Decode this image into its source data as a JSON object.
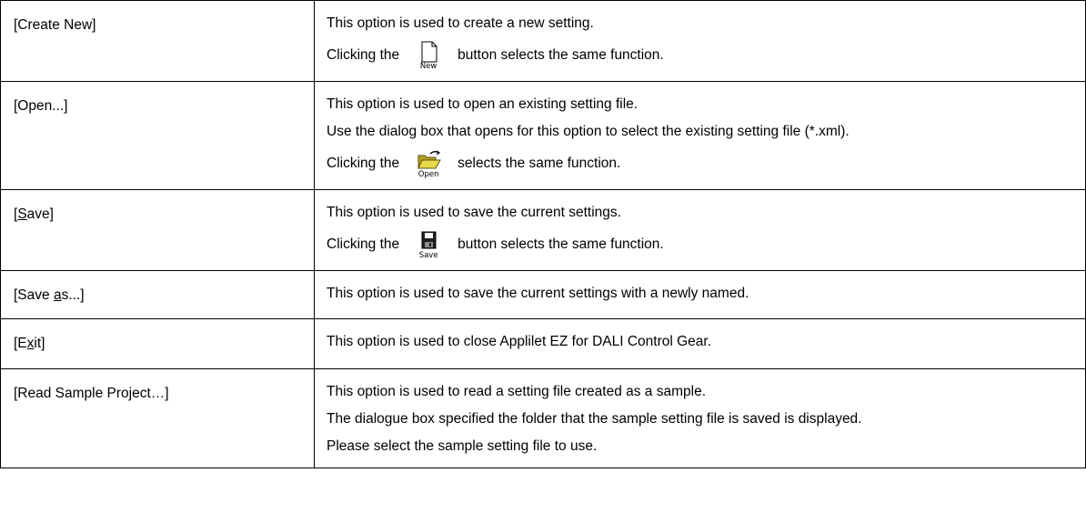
{
  "rows": [
    {
      "option": {
        "pre": "[Create New]",
        "ul": "",
        "post": ""
      },
      "lines": [
        "This option is used to create a new setting."
      ],
      "icon_line": {
        "before": "Clicking the",
        "icon": "new-document-icon",
        "caption": "New",
        "after": "button selects the same function."
      }
    },
    {
      "option": {
        "pre": "[Open...]",
        "ul": "",
        "post": ""
      },
      "lines": [
        "This option is used to open an existing setting file.",
        "Use the dialog box that opens for this option to select the existing setting file (*.xml)."
      ],
      "icon_line": {
        "before": "Clicking the",
        "icon": "open-folder-icon",
        "caption": "Open",
        "after": "selects the same function."
      }
    },
    {
      "option": {
        "pre": "[",
        "ul": "S",
        "post": "ave]"
      },
      "lines": [
        "This option is used to save the current settings."
      ],
      "icon_line": {
        "before": "Clicking the",
        "icon": "save-disk-icon",
        "caption": "Save",
        "after": "button selects the same function."
      }
    },
    {
      "option": {
        "pre": "[Save ",
        "ul": "a",
        "post": "s...]"
      },
      "lines": [
        "This option is used to save the current settings with a newly named."
      ]
    },
    {
      "option": {
        "pre": "[E",
        "ul": "x",
        "post": "it]"
      },
      "lines": [
        "This option is used to close Applilet EZ for DALI Control Gear."
      ]
    },
    {
      "option": {
        "pre": "[Read Sample Project…]",
        "ul": "",
        "post": ""
      },
      "lines": [
        "This option is used to read a setting file created as a sample.",
        "The dialogue box specified the folder that the sample setting file is saved is displayed.",
        "Please select the sample setting file to use."
      ]
    }
  ]
}
